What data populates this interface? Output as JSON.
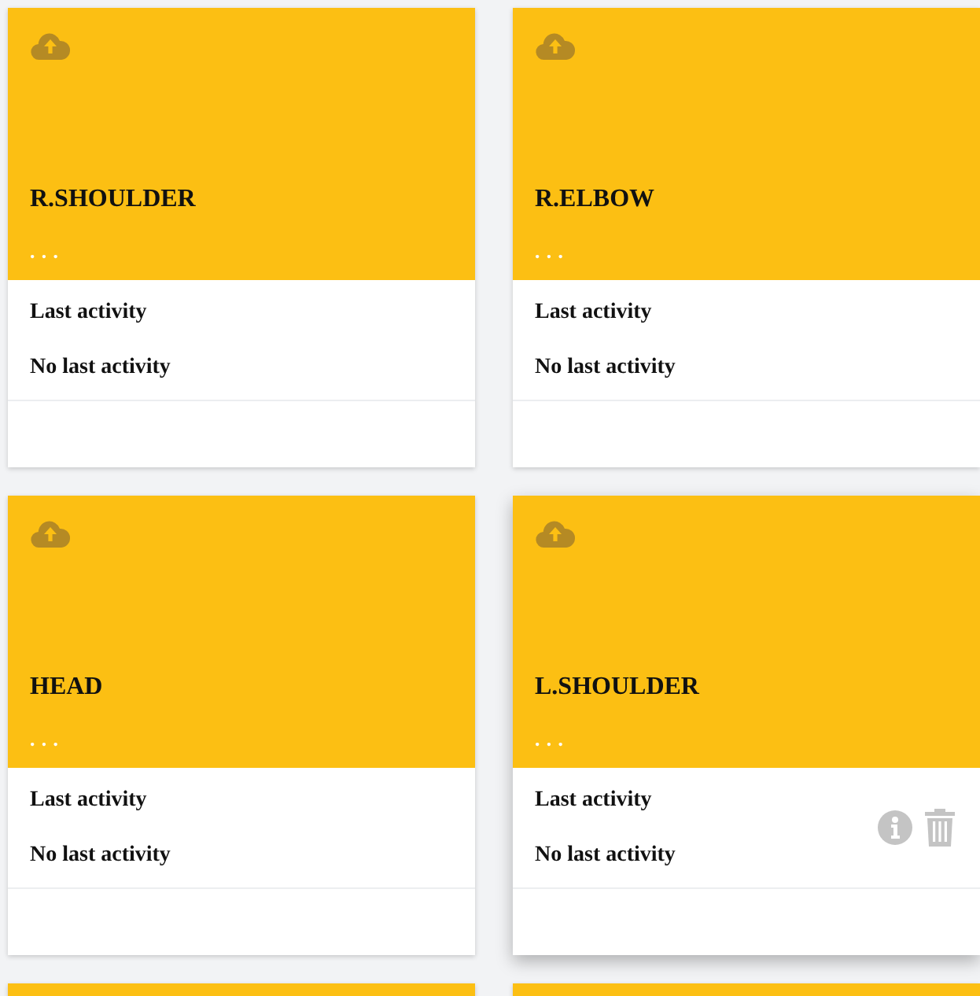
{
  "cards": [
    {
      "kind": "full",
      "title": "R.SHOULDER",
      "menu": "• • •",
      "activity_label": "Last activity",
      "activity_value": "No last activity",
      "hovered": false
    },
    {
      "kind": "full",
      "title": "R.ELBOW",
      "menu": "• • •",
      "activity_label": "Last activity",
      "activity_value": "No last activity",
      "hovered": false
    },
    {
      "kind": "full",
      "title": "HEAD",
      "menu": "• • •",
      "activity_label": "Last activity",
      "activity_value": "No last activity",
      "hovered": false
    },
    {
      "kind": "full",
      "title": "L.SHOULDER",
      "menu": "• • •",
      "activity_label": "Last activity",
      "activity_value": "No last activity",
      "hovered": true
    },
    {
      "kind": "clipped"
    },
    {
      "kind": "clipped"
    }
  ]
}
